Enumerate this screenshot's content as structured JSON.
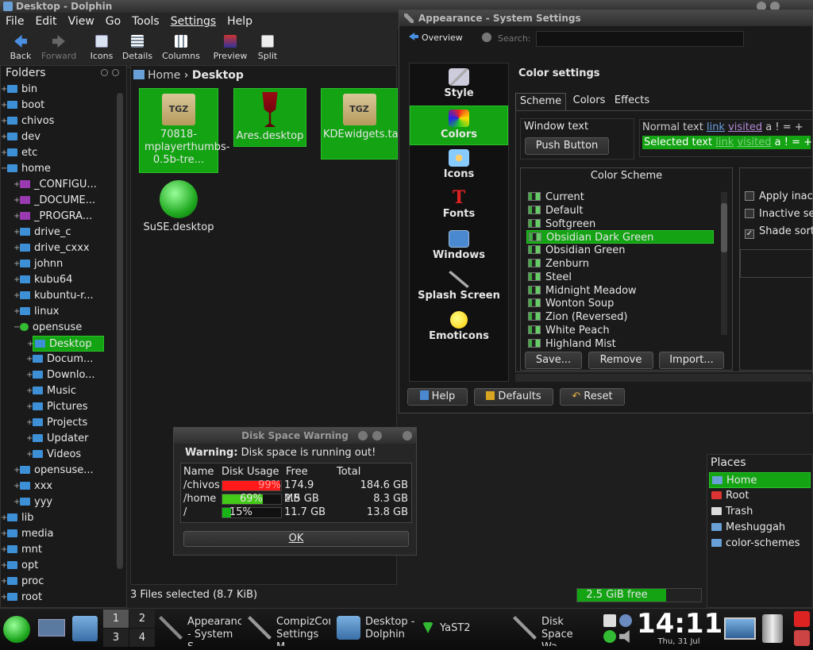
{
  "dolphin": {
    "title": "Desktop - Dolphin",
    "menu": [
      "File",
      "Edit",
      "View",
      "Go",
      "Tools",
      "Settings",
      "Help"
    ],
    "toolbar": {
      "back": "Back",
      "forward": "Forward",
      "icons": "Icons",
      "details": "Details",
      "columns": "Columns",
      "preview": "Preview",
      "split": "Split"
    },
    "folders_title": "Folders",
    "tree": [
      "bin",
      "boot",
      "chivos",
      "dev",
      "etc",
      "home",
      "_CONFIGU...",
      "_DOCUME...",
      "_PROGRA...",
      "drive_c",
      "drive_cxxx",
      "johnn",
      "kubu64",
      "kubuntu-r...",
      "linux",
      "opensuse",
      "Desktop",
      "Docum...",
      "Downlo...",
      "Music",
      "Pictures",
      "Projects",
      "Updater",
      "Videos",
      "opensuse...",
      "xxx",
      "yyy",
      "lib",
      "media",
      "mnt",
      "opt",
      "proc",
      "root"
    ],
    "breadcrumb": {
      "home": "Home",
      "current": "Desktop"
    },
    "files": [
      "70818-mplayerthumbs-0.5b-tre...",
      "Ares.desktop",
      "KDEwidgets.tar.gz",
      "SuSE.desktop"
    ],
    "tgz_label": "TGZ",
    "status": "3 Files selected (8.7 KiB)",
    "free": "2.5 GiB free",
    "places_title": "Places",
    "places": [
      "Home",
      "Root",
      "Trash",
      "Meshuggah",
      "color-schemes"
    ]
  },
  "settings": {
    "title": "Appearance - System Settings",
    "overview": "Overview",
    "search_label": "Search:",
    "search_value": "",
    "categories": [
      "Style",
      "Colors",
      "Icons",
      "Fonts",
      "Windows",
      "Splash Screen",
      "Emoticons"
    ],
    "heading": "Color settings",
    "tabs": [
      "Scheme",
      "Colors",
      "Effects"
    ],
    "window_text": "Window text",
    "push_button": "Push Button",
    "preview_normal": "Normal text",
    "preview_selected": "Selected text",
    "preview_link": "link",
    "preview_visited": "visited",
    "preview_tail": "a  !  = +",
    "scheme_title": "Color Scheme",
    "schemes": [
      "Current",
      "Default",
      "Softgreen",
      "Obsidian Dark Green",
      "Obsidian Green",
      "Zenburn",
      "Steel",
      "Midnight Meadow",
      "Wonton Soup",
      "Zion (Reversed)",
      "White Peach",
      "Highland Mist"
    ],
    "scheme_buttons": [
      "Save...",
      "Remove",
      "Import..."
    ],
    "options": [
      "Apply inact",
      "Inactive se",
      "Shade sort"
    ],
    "bottom_buttons": [
      "Help",
      "Defaults",
      "Reset"
    ]
  },
  "warning": {
    "title": "Disk Space Warning",
    "message_bold": "Warning:",
    "message": "Disk space is running out!",
    "headers": [
      "Name",
      "Disk Usage",
      "Free",
      "Total"
    ],
    "rows": [
      {
        "name": "/chivos",
        "usage": "99%",
        "pct": 0.99,
        "free": "174.9 MB",
        "total": "184.6 GB",
        "color": "#ff1a1a"
      },
      {
        "name": "/home",
        "usage": "69%",
        "pct": 0.69,
        "free": "2.5 GB",
        "total": "8.3 GB",
        "color": "#43c918"
      },
      {
        "name": "/",
        "usage": "15%",
        "pct": 0.15,
        "free": "11.7 GB",
        "total": "13.8 GB",
        "color": "#17b317"
      }
    ],
    "ok": "OK"
  },
  "taskbar": {
    "pager": [
      "1",
      "2",
      "3",
      "4"
    ],
    "tasks": [
      "Appearance - System S",
      "CompizConfig Settings M",
      "Desktop - Dolphin",
      "YaST2",
      "Disk Space Wa"
    ],
    "clock": "14:11",
    "date": "Thu, 31 Jul"
  },
  "colors": {
    "accent": "#13a313",
    "folder": "#3d8fd6"
  }
}
